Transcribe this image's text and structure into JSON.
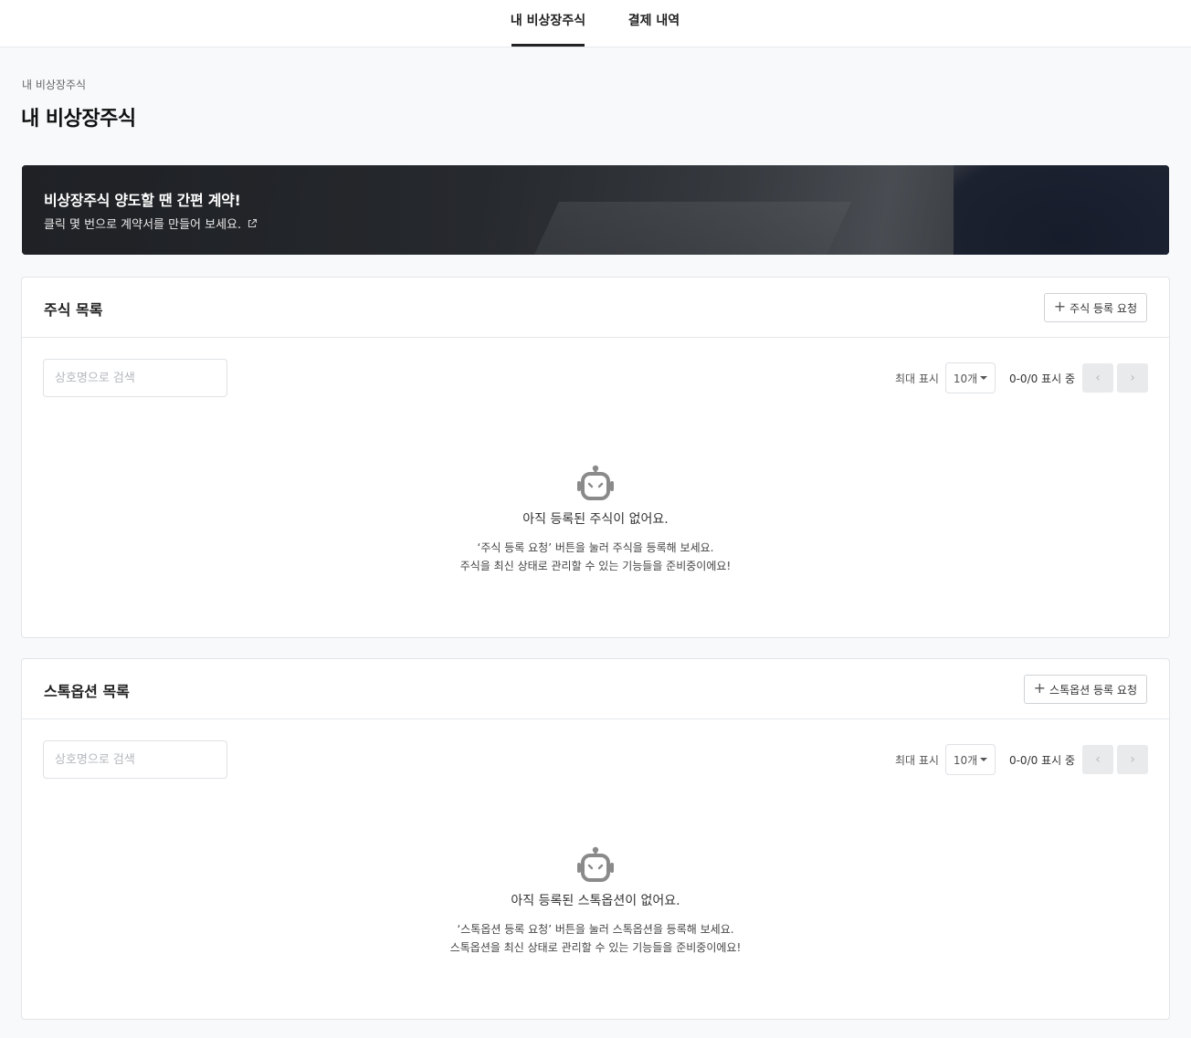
{
  "tabs": [
    {
      "label": "내 비상장주식",
      "active": true
    },
    {
      "label": "결제 내역",
      "active": false
    }
  ],
  "breadcrumb": "내 비상장주식",
  "page_title": "내 비상장주식",
  "banner": {
    "title": "비상장주식 양도할 땐 간편 계약!",
    "subtitle": "클릭 몇 번으로 계약서를 만들어 보세요.",
    "icon": "external-link-icon"
  },
  "stocks": {
    "title": "주식 목록",
    "add_label": "주식 등록 요청",
    "search_placeholder": "상호명으로 검색",
    "max_label": "최대 표시",
    "page_size": "10개",
    "range": "0-0/0 표시 중",
    "prev": "‹",
    "next": "›",
    "empty_title": "아직 등록된 주식이 없어요.",
    "empty_line1": "‘주식 등록 요청’ 버튼을 눌러 주식을 등록해 보세요.",
    "empty_line2": "주식을 최신 상태로 관리할 수 있는 기능들을 준비중이에요!"
  },
  "options": {
    "title": "스톡옵션 목록",
    "add_label": "스톡옵션 등록 요청",
    "search_placeholder": "상호명으로 검색",
    "max_label": "최대 표시",
    "page_size": "10개",
    "range": "0-0/0 표시 중",
    "prev": "‹",
    "next": "›",
    "empty_title": "아직 등록된 스톡옵션이 없어요.",
    "empty_line1": "‘스톡옵션 등록 요청’ 버튼을 눌러 스톡옵션을 등록해 보세요.",
    "empty_line2": "스톡옵션을 최신 상태로 관리할 수 있는 기능들을 준비중이에요!"
  },
  "colors": {
    "active_tab_underline": "#222222",
    "pager_button_bg": "#e9eaec",
    "robot_icon": "#8a8a8a"
  }
}
